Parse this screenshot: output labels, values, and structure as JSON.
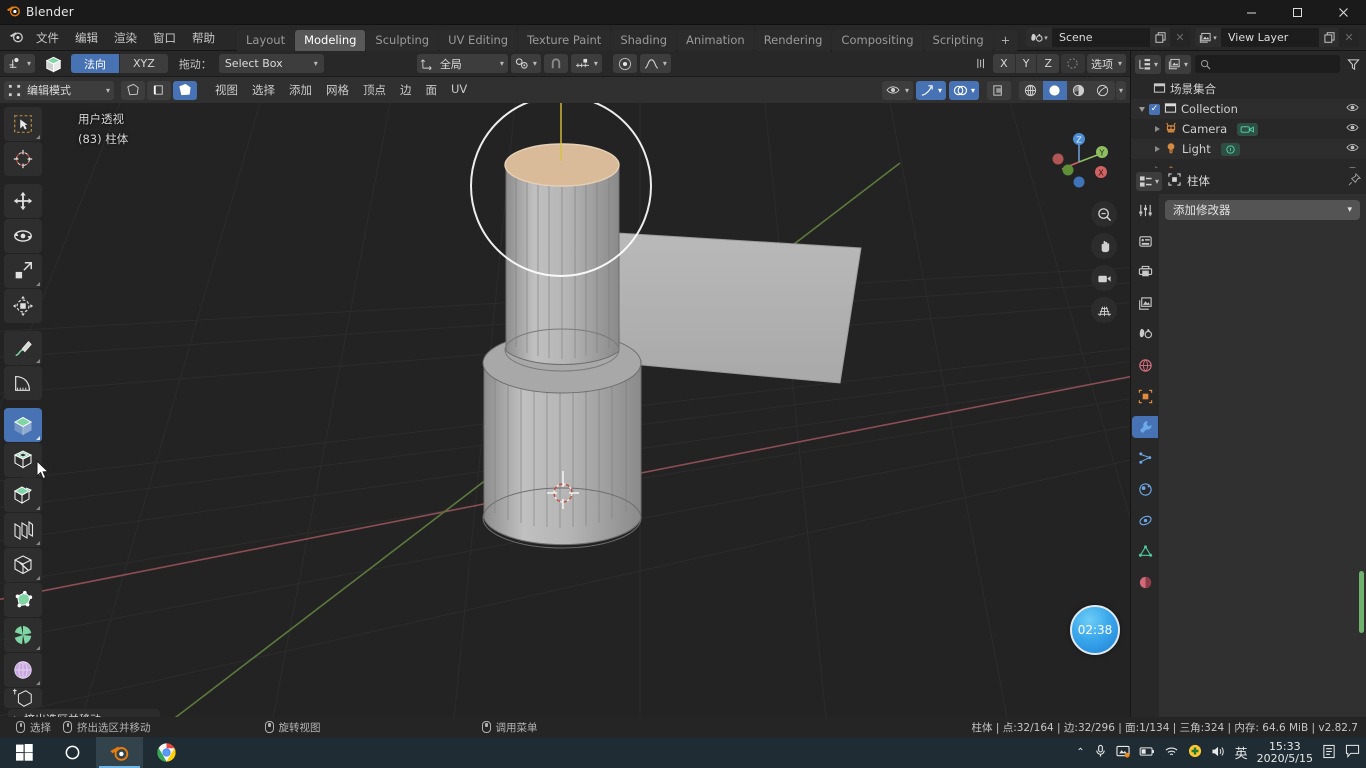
{
  "window": {
    "title": "Blender",
    "minimize": "–",
    "maximize": "▢",
    "close": "✕"
  },
  "topbar": {
    "menus": [
      "文件",
      "编辑",
      "渲染",
      "窗口",
      "帮助"
    ],
    "workspaces": [
      {
        "label": "Layout",
        "active": false
      },
      {
        "label": "Modeling",
        "active": true
      },
      {
        "label": "Sculpting",
        "active": false
      },
      {
        "label": "UV Editing",
        "active": false
      },
      {
        "label": "Texture Paint",
        "active": false
      },
      {
        "label": "Shading",
        "active": false
      },
      {
        "label": "Animation",
        "active": false
      },
      {
        "label": "Rendering",
        "active": false
      },
      {
        "label": "Compositing",
        "active": false
      },
      {
        "label": "Scripting",
        "active": false
      }
    ],
    "add_workspace": "+",
    "scene": {
      "name": "Scene",
      "new_icon": "copy-icon",
      "unlink_icon": "x-icon"
    },
    "view_layer": {
      "name": "View Layer",
      "new_icon": "copy-icon",
      "unlink_icon": "x-icon"
    }
  },
  "tool_settings": {
    "orientation_options": [
      "法向",
      "XYZ"
    ],
    "orientation_active": "法向",
    "drag_label": "拖动：",
    "drag_value": "Select Box",
    "transform_orientation": "全局",
    "options_label": "选项",
    "axis_toggles": [
      "X",
      "Y",
      "Z"
    ]
  },
  "viewport_header": {
    "mode": "编辑模式",
    "menus": [
      "视图",
      "选择",
      "添加",
      "网格",
      "顶点",
      "边",
      "面",
      "UV"
    ],
    "select_modes": [
      "vertex-select-icon",
      "edge-select-icon",
      "face-select-icon"
    ],
    "select_mode_active": 2
  },
  "viewport": {
    "perspective_label": "用户透视",
    "object_label": "(83) 柱体",
    "gizmo_axes": [
      "X",
      "Y",
      "Z"
    ],
    "nav_icons": [
      "zoom-icon",
      "hand-icon",
      "camera-icon",
      "grid-icon"
    ],
    "operator_panel": "挤出选区并移动"
  },
  "outliner": {
    "search_placeholder": "",
    "root": "场景集合",
    "items": [
      {
        "label": "Collection",
        "icon": "collection-icon",
        "depth": 0,
        "checkbox": true,
        "expand": true
      },
      {
        "label": "Camera",
        "icon": "camera-object-icon",
        "depth": 1,
        "data_icon": "camera-data-icon"
      },
      {
        "label": "Light",
        "icon": "light-object-icon",
        "depth": 1,
        "data_icon": "light-data-icon"
      }
    ]
  },
  "properties": {
    "breadcrumb_object": "柱体",
    "pin_icon": "pin-icon",
    "tabs": [
      {
        "name": "tool-tab",
        "icon": "tool-icon",
        "active": false
      },
      {
        "name": "render-tab",
        "icon": "render-icon",
        "active": false
      },
      {
        "name": "output-tab",
        "icon": "printer-icon",
        "active": false
      },
      {
        "name": "view-layer-tab",
        "icon": "images-icon",
        "active": false
      },
      {
        "name": "scene-tab",
        "icon": "scene-icon",
        "active": false
      },
      {
        "name": "world-tab",
        "icon": "world-icon",
        "active": false
      },
      {
        "name": "object-tab",
        "icon": "object-icon",
        "active": false
      },
      {
        "name": "modifier-tab",
        "icon": "wrench-icon",
        "active": true
      },
      {
        "name": "particles-tab",
        "icon": "particles-icon",
        "active": false
      },
      {
        "name": "physics-tab",
        "icon": "physics-icon",
        "active": false
      },
      {
        "name": "constraints-tab",
        "icon": "constraint-icon",
        "active": false
      },
      {
        "name": "data-tab",
        "icon": "mesh-data-icon",
        "active": false
      },
      {
        "name": "material-tab",
        "icon": "material-icon",
        "active": false
      }
    ],
    "add_modifier": "添加修改器"
  },
  "statusbar": {
    "hints": [
      {
        "icon": "mouse-left-icon",
        "label": "选择"
      },
      {
        "icon": "mouse-left-drag-icon",
        "label": "挤出选区并移动"
      },
      {
        "icon": "mouse-middle-icon",
        "label": "旋转视图"
      },
      {
        "icon": "mouse-right-icon",
        "label": "调用菜单"
      }
    ],
    "stats": "柱体 | 点:32/164 | 边:32/296 | 面:1/134 | 三角:324  | 内存: 64.6 MiB | v2.82.7"
  },
  "taskbar": {
    "start_icon": "windows-icon",
    "search_icon": "cortana-icon",
    "apps": [
      {
        "name": "blender-taskbar-icon",
        "active": true
      },
      {
        "name": "chrome-taskbar-icon",
        "active": false
      }
    ],
    "tray_icons": [
      "chevron-up-icon",
      "microphone-icon",
      "display-icon",
      "battery-icon",
      "wifi-icon",
      "security-icon",
      "volume-icon"
    ],
    "ime": "英",
    "time": "15:33",
    "date": "2020/5/15",
    "notes_icon": "notes-icon",
    "notification_icon": "notification-icon"
  },
  "recorder": {
    "timer": "02:38"
  },
  "colors": {
    "accent_blue": "#4772b3",
    "header_bg": "#282828",
    "viewport_bg": "#232323",
    "panel_bg": "#303030",
    "taskbar_bg": "#1f2c33",
    "blender_orange": "#e87d0d"
  }
}
